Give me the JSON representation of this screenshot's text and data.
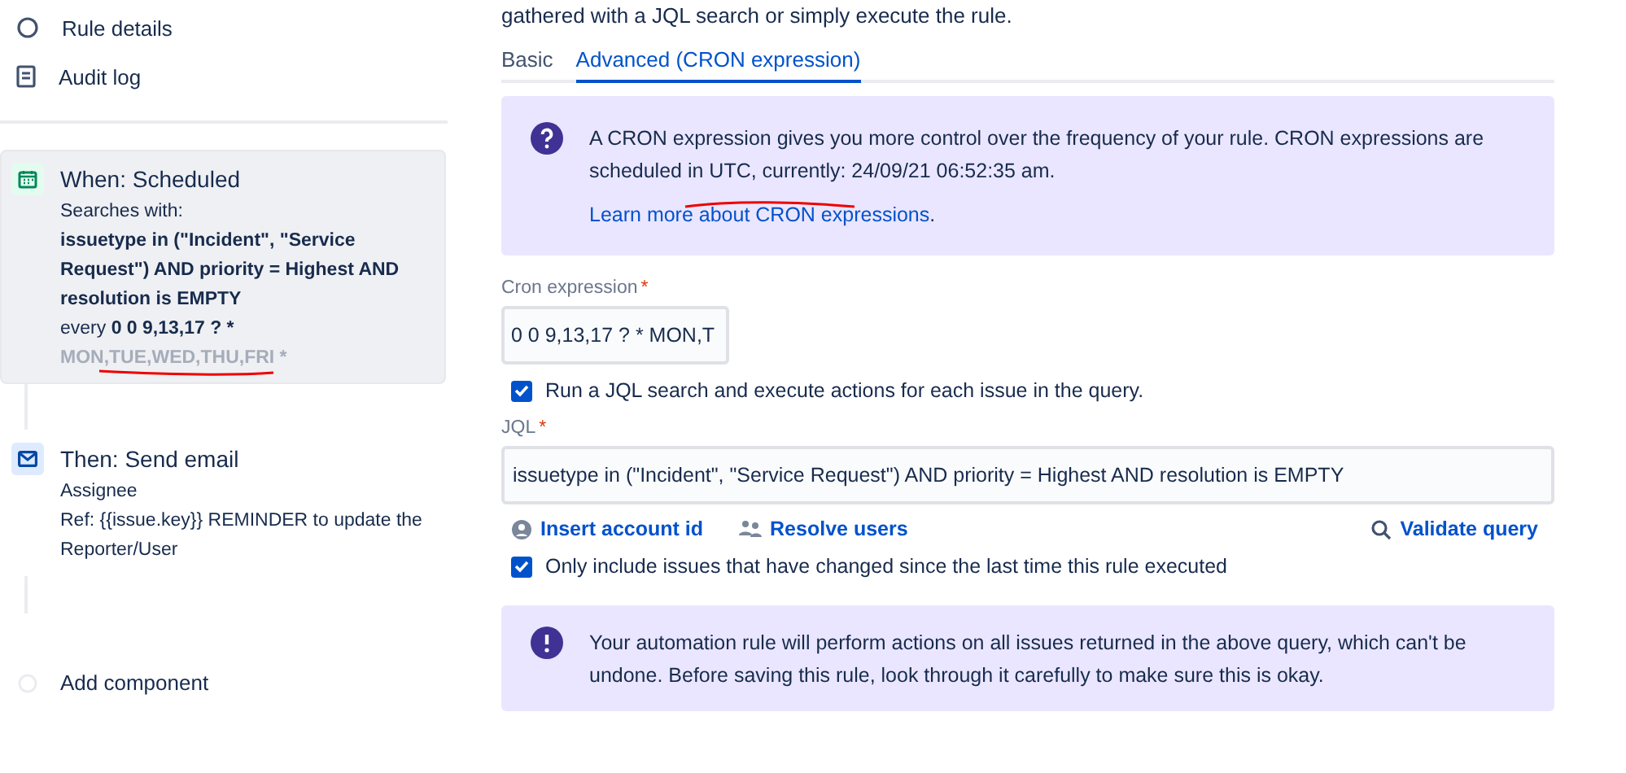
{
  "sidebar": {
    "nav_items": [
      {
        "label": "Rule details"
      },
      {
        "label": "Audit log"
      }
    ],
    "components": [
      {
        "kind": "trigger",
        "title": "When: Scheduled",
        "selected": true,
        "lines": [
          "Searches with:",
          "**issuetype in (\"Incident\", \"Service Request\") AND priority = Highest AND resolution is EMPTY**",
          "every **0 0 9,13,17 ? ***"
        ],
        "faded_line": "MON,TUE,WED,THU,FRI *"
      },
      {
        "kind": "action",
        "title": "Then: Send email",
        "selected": false,
        "lines": [
          "Assignee",
          "Ref: {{issue.key}} REMINDER to update the Reporter/User"
        ]
      },
      {
        "kind": "add",
        "title": "Add component",
        "selected": false
      }
    ]
  },
  "main": {
    "intro": "gathered with a JQL search or simply execute the rule.",
    "tabs": [
      {
        "label": "Basic",
        "selected": false
      },
      {
        "label": "Advanced (CRON expression)",
        "selected": true
      }
    ],
    "info_panel": {
      "text": "A CRON expression gives you more control over the frequency of your rule. CRON expressions are scheduled in UTC, currently: 24/09/21 06:52:35 am.",
      "link": "Learn more about CRON expressions",
      "link_suffix": "."
    },
    "cron_field": {
      "label": "Cron expression",
      "required_mark": "*",
      "value": "0 0 9,13,17 ? * MON,T"
    },
    "run_jql": {
      "label": "Run a JQL search and execute actions for each issue in the query.",
      "checked": true
    },
    "jql_field": {
      "label": "JQL",
      "required_mark": "*",
      "value": "issuetype in (\"Incident\", \"Service Request\") AND priority = Highest AND resolution is EMPTY"
    },
    "jql_actions": [
      {
        "label": "Insert account id"
      },
      {
        "label": "Resolve users"
      },
      {
        "label": "Validate query"
      }
    ],
    "only_changed": {
      "label": "Only include issues that have changed since the last time this rule executed",
      "checked": true
    },
    "warning_panel": {
      "text": "Your automation rule will perform actions on all issues returned in the above query, which can't be undone. Before saving this rule, look through it carefully to make sure this is okay."
    }
  }
}
